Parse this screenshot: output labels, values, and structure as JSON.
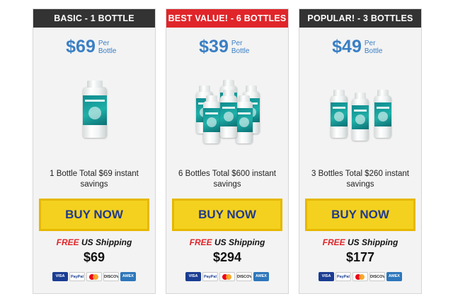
{
  "cards": [
    {
      "header": "BASIC - 1 BOTTLE",
      "price": "$69",
      "per_label": "Per Bottle",
      "description": "1 Bottle Total $69 instant savings",
      "button": "BUY NOW",
      "free": "FREE",
      "shipping": "US Shipping",
      "total": "$69",
      "header_color": "#333333"
    },
    {
      "header": "BEST VALUE! - 6 BOTTLES",
      "price": "$39",
      "per_label": "Per Bottle",
      "description": "6 Bottles Total $600 instant savings",
      "button": "BUY NOW",
      "free": "FREE",
      "shipping": "US Shipping",
      "total": "$294",
      "header_color": "#e0252a"
    },
    {
      "header": "POPULAR! - 3 BOTTLES",
      "price": "$49",
      "per_label": "Per Bottle",
      "description": "3 Bottles Total $260 instant savings",
      "button": "BUY NOW",
      "free": "FREE",
      "shipping": "US Shipping",
      "total": "$177",
      "header_color": "#333333"
    }
  ],
  "payment": {
    "visa": "VISA",
    "paypal": "PayPal",
    "discover": "DISCOVER",
    "amex": "AMEX"
  },
  "colors": {
    "accent_blue": "#3a7fc4",
    "button_yellow": "#f4d11f",
    "button_text": "#203a8c",
    "free_red": "#e0252a"
  }
}
